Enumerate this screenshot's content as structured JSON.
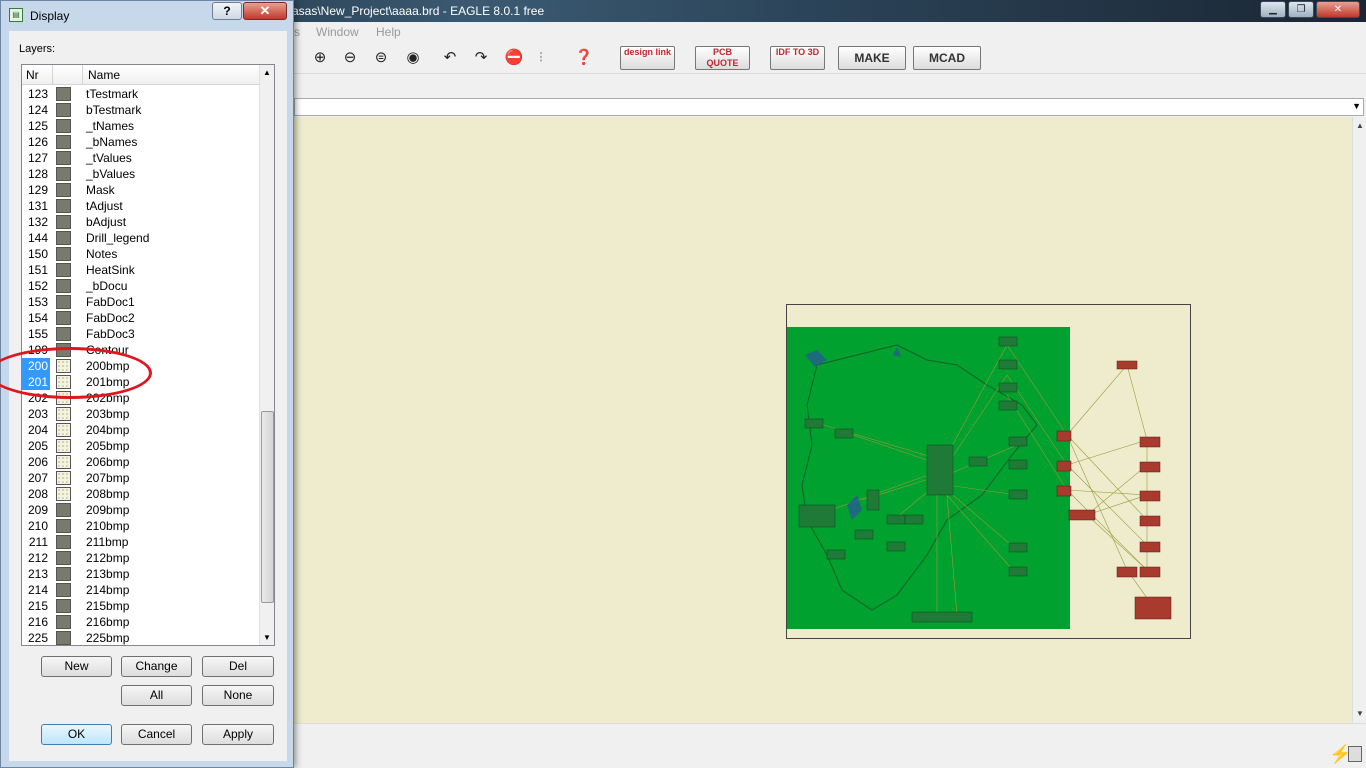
{
  "window": {
    "title": "asas\\New_Project\\aaaa.brd - EAGLE 8.0.1 free"
  },
  "menu": [
    "s",
    "Window",
    "Help"
  ],
  "toolbar": {
    "designlink": "design link",
    "pcbquote": "PCB QUOTE",
    "idf": "IDF TO 3D",
    "make": "MAKE",
    "mcad": "MCAD"
  },
  "dialog": {
    "title": "Display",
    "layers_label": "Layers:",
    "col_nr": "Nr",
    "col_name": "Name",
    "rows": [
      {
        "nr": "123",
        "name": "tTestmark",
        "sel": false,
        "dot": false
      },
      {
        "nr": "124",
        "name": "bTestmark",
        "sel": false,
        "dot": false
      },
      {
        "nr": "125",
        "name": "_tNames",
        "sel": false,
        "dot": false
      },
      {
        "nr": "126",
        "name": "_bNames",
        "sel": false,
        "dot": false
      },
      {
        "nr": "127",
        "name": "_tValues",
        "sel": false,
        "dot": false
      },
      {
        "nr": "128",
        "name": "_bValues",
        "sel": false,
        "dot": false
      },
      {
        "nr": "129",
        "name": "Mask",
        "sel": false,
        "dot": false
      },
      {
        "nr": "131",
        "name": "tAdjust",
        "sel": false,
        "dot": false
      },
      {
        "nr": "132",
        "name": "bAdjust",
        "sel": false,
        "dot": false
      },
      {
        "nr": "144",
        "name": "Drill_legend",
        "sel": false,
        "dot": false
      },
      {
        "nr": "150",
        "name": "Notes",
        "sel": false,
        "dot": false
      },
      {
        "nr": "151",
        "name": "HeatSink",
        "sel": false,
        "dot": false
      },
      {
        "nr": "152",
        "name": "_bDocu",
        "sel": false,
        "dot": false
      },
      {
        "nr": "153",
        "name": "FabDoc1",
        "sel": false,
        "dot": false
      },
      {
        "nr": "154",
        "name": "FabDoc2",
        "sel": false,
        "dot": false
      },
      {
        "nr": "155",
        "name": "FabDoc3",
        "sel": false,
        "dot": false
      },
      {
        "nr": "199",
        "name": "Contour",
        "sel": false,
        "dot": false
      },
      {
        "nr": "200",
        "name": "200bmp",
        "sel": true,
        "dot": true
      },
      {
        "nr": "201",
        "name": "201bmp",
        "sel": true,
        "dot": true
      },
      {
        "nr": "202",
        "name": "202bmp",
        "sel": false,
        "dot": true
      },
      {
        "nr": "203",
        "name": "203bmp",
        "sel": false,
        "dot": true
      },
      {
        "nr": "204",
        "name": "204bmp",
        "sel": false,
        "dot": true
      },
      {
        "nr": "205",
        "name": "205bmp",
        "sel": false,
        "dot": true
      },
      {
        "nr": "206",
        "name": "206bmp",
        "sel": false,
        "dot": true
      },
      {
        "nr": "207",
        "name": "207bmp",
        "sel": false,
        "dot": true
      },
      {
        "nr": "208",
        "name": "208bmp",
        "sel": false,
        "dot": true
      },
      {
        "nr": "209",
        "name": "209bmp",
        "sel": false,
        "dot": false
      },
      {
        "nr": "210",
        "name": "210bmp",
        "sel": false,
        "dot": false
      },
      {
        "nr": "211",
        "name": "211bmp",
        "sel": false,
        "dot": false
      },
      {
        "nr": "212",
        "name": "212bmp",
        "sel": false,
        "dot": false
      },
      {
        "nr": "213",
        "name": "213bmp",
        "sel": false,
        "dot": false
      },
      {
        "nr": "214",
        "name": "214bmp",
        "sel": false,
        "dot": false
      },
      {
        "nr": "215",
        "name": "215bmp",
        "sel": false,
        "dot": false
      },
      {
        "nr": "216",
        "name": "216bmp",
        "sel": false,
        "dot": false
      },
      {
        "nr": "225",
        "name": "225bmp",
        "sel": false,
        "dot": false
      }
    ],
    "buttons": {
      "new": "New",
      "change": "Change",
      "del": "Del",
      "all": "All",
      "none": "None",
      "ok": "OK",
      "cancel": "Cancel",
      "apply": "Apply"
    }
  },
  "colors": {
    "canvas": "#eeeccd",
    "board_fill": "#00a12e",
    "selection": "#3399ff",
    "annotation": "#e0161e"
  }
}
